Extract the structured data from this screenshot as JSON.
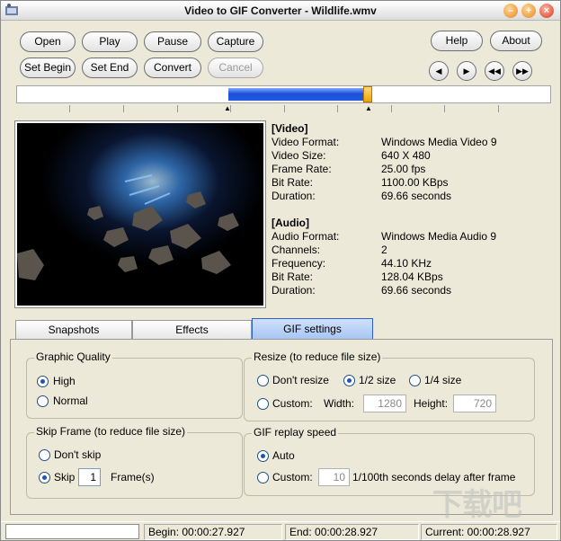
{
  "window": {
    "title": "Video to GIF Converter - Wildlife.wmv"
  },
  "toolbar": {
    "open": "Open",
    "play": "Play",
    "pause": "Pause",
    "capture": "Capture",
    "set_begin": "Set Begin",
    "set_end": "Set End",
    "convert": "Convert",
    "cancel": "Cancel",
    "help": "Help",
    "about": "About"
  },
  "nav_icons": [
    "prev-frame-icon",
    "next-frame-icon",
    "rewind-icon",
    "fast-forward-icon"
  ],
  "timeline": {
    "selection_start_fraction": 0.395,
    "selection_end_fraction": 0.66,
    "position_fraction": 0.655
  },
  "info": {
    "video_header": "[Video]",
    "rows_video": [
      {
        "k": "Video Format:",
        "v": "Windows Media Video 9"
      },
      {
        "k": "Video Size:",
        "v": "640 X 480"
      },
      {
        "k": "Frame Rate:",
        "v": "25.00 fps"
      },
      {
        "k": "Bit Rate:",
        "v": "1100.00 KBps"
      },
      {
        "k": "Duration:",
        "v": "69.66 seconds"
      }
    ],
    "audio_header": "[Audio]",
    "rows_audio": [
      {
        "k": "Audio Format:",
        "v": "Windows Media Audio 9"
      },
      {
        "k": "Channels:",
        "v": "2"
      },
      {
        "k": "Frequency:",
        "v": "44.10 KHz"
      },
      {
        "k": "Bit Rate:",
        "v": "128.04 KBps"
      },
      {
        "k": "Duration:",
        "v": "69.66 seconds"
      }
    ]
  },
  "tabs": [
    "Snapshots",
    "Effects",
    "GIF settings"
  ],
  "gif": {
    "quality": {
      "label": "Graphic Quality",
      "high": "High",
      "normal": "Normal",
      "selected": "High"
    },
    "resize": {
      "label": "Resize (to reduce file size)",
      "none": "Don't resize",
      "half": "1/2 size",
      "quarter": "1/4 size",
      "custom": "Custom:",
      "width_label": "Width:",
      "height_label": "Height:",
      "width": "1280",
      "height": "720",
      "selected": "1/2 size"
    },
    "skip": {
      "label": "Skip Frame (to reduce file size)",
      "dont": "Don't skip",
      "skip": "Skip",
      "frames": "1",
      "frames_label": "Frame(s)",
      "selected": "Skip"
    },
    "replay": {
      "label": "GIF replay speed",
      "auto": "Auto",
      "custom": "Custom:",
      "delay": "10",
      "delay_label": "1/100th seconds delay after frame",
      "selected": "Auto"
    }
  },
  "status": {
    "begin": "Begin: 00:00:27.927",
    "end": "End: 00:00:28.927",
    "current": "Current: 00:00:28.927"
  },
  "colors": {
    "selection": "#2058e0",
    "thumb": "#f3a300",
    "active_tab": "#a8c6f3"
  }
}
